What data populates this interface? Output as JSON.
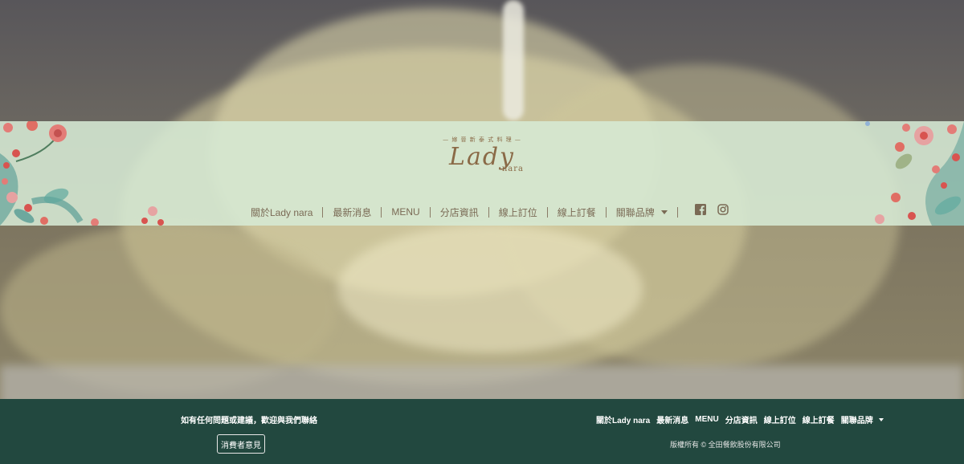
{
  "logo": {
    "tagline": "— 嫁 晉 新 泰 式 料 理 —",
    "main": "Lady",
    "sub": "nara"
  },
  "nav": {
    "items": [
      {
        "label": "關於Lady nara"
      },
      {
        "label": "最新消息"
      },
      {
        "label": "MENU"
      },
      {
        "label": "分店資訊"
      },
      {
        "label": "線上訂位"
      },
      {
        "label": "線上訂餐"
      },
      {
        "label": "關聯品牌"
      }
    ],
    "icons": {
      "facebook": "facebook-icon",
      "instagram": "instagram-icon"
    }
  },
  "footer": {
    "contact_text": "如有任何問題或建議，歡迎與我們聯絡",
    "feedback_button": "消費者意見",
    "nav": [
      {
        "label": "關於Lady nara"
      },
      {
        "label": "最新消息"
      },
      {
        "label": "MENU"
      },
      {
        "label": "分店資訊"
      },
      {
        "label": "線上訂位"
      },
      {
        "label": "線上訂餐"
      },
      {
        "label": "關聯品牌"
      }
    ],
    "copyright": "版權所有 © 全田餐飲股份有限公司"
  },
  "colors": {
    "header_band": "#d6e9d4",
    "footer_bg": "#22483f",
    "brand_brown": "#8a6a47",
    "nav_text": "#7a6a55"
  }
}
